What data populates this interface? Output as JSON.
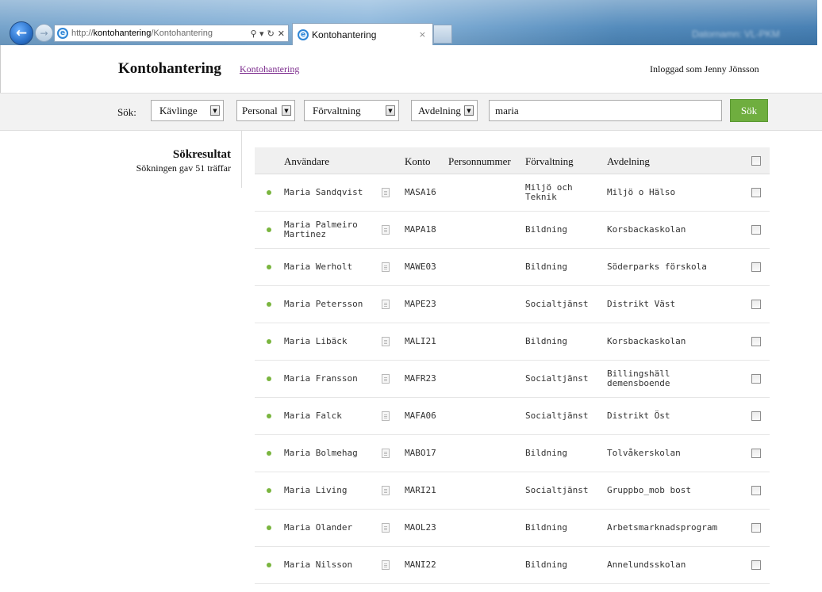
{
  "browser": {
    "address_protocol": "http://",
    "address_host": "kontohantering",
    "address_path": "/Kontohantering",
    "tab_title": "Kontohantering",
    "tab_close": "×",
    "search_glyph": "⚲ ▾",
    "refresh_glyph": "↻",
    "stop_glyph": "✕",
    "blurred_right_text": "Datornamn: VL-PKM"
  },
  "header": {
    "app_title": "Kontohantering",
    "app_link": "Kontohantering",
    "logged_in": "Inloggad som Jenny Jönsson"
  },
  "search": {
    "label": "Sök:",
    "municipality": "Kävlinge",
    "category": "Personal",
    "department_placeholder": "Förvaltning",
    "unit_placeholder": "Avdelning",
    "query": "maria",
    "button": "Sök"
  },
  "results": {
    "title": "Sökresultat",
    "summary": "Sökningen gav 51 träffar",
    "columns": [
      "Användare",
      "Konto",
      "Personnummer",
      "Förvaltning",
      "Avdelning"
    ],
    "rows": [
      {
        "user": [
          "Maria Sandqvist"
        ],
        "account": "MASA16",
        "pnr": "",
        "dept": [
          "Miljö och",
          "Teknik"
        ],
        "unit": [
          "Miljö o Hälso"
        ]
      },
      {
        "user": [
          "Maria Palmeiro",
          "Martinez"
        ],
        "account": "MAPA18",
        "pnr": "",
        "dept": [
          "Bildning"
        ],
        "unit": [
          "Korsbackaskolan"
        ]
      },
      {
        "user": [
          "Maria Werholt"
        ],
        "account": "MAWE03",
        "pnr": "",
        "dept": [
          "Bildning"
        ],
        "unit": [
          "Söderparks förskola"
        ]
      },
      {
        "user": [
          "Maria Petersson"
        ],
        "account": "MAPE23",
        "pnr": "",
        "dept": [
          "Socialtjänst"
        ],
        "unit": [
          "Distrikt Väst"
        ]
      },
      {
        "user": [
          "Maria Libäck"
        ],
        "account": "MALI21",
        "pnr": "",
        "dept": [
          "Bildning"
        ],
        "unit": [
          "Korsbackaskolan"
        ]
      },
      {
        "user": [
          "Maria Fransson"
        ],
        "account": "MAFR23",
        "pnr": "",
        "dept": [
          "Socialtjänst"
        ],
        "unit": [
          "Billingshäll",
          "demensboende"
        ]
      },
      {
        "user": [
          "Maria Falck"
        ],
        "account": "MAFA06",
        "pnr": "",
        "dept": [
          "Socialtjänst"
        ],
        "unit": [
          "Distrikt Öst"
        ]
      },
      {
        "user": [
          "Maria Bolmehag"
        ],
        "account": "MABO17",
        "pnr": "",
        "dept": [
          "Bildning"
        ],
        "unit": [
          "Tolvåkerskolan"
        ]
      },
      {
        "user": [
          "Maria Living"
        ],
        "account": "MARI21",
        "pnr": "",
        "dept": [
          "Socialtjänst"
        ],
        "unit": [
          "Gruppbo_mob bost"
        ]
      },
      {
        "user": [
          "Maria Olander"
        ],
        "account": "MAOL23",
        "pnr": "",
        "dept": [
          "Bildning"
        ],
        "unit": [
          "Arbetsmarknadsprogram"
        ]
      },
      {
        "user": [
          "Maria Nilsson"
        ],
        "account": "MANI22",
        "pnr": "",
        "dept": [
          "Bildning"
        ],
        "unit": [
          "Annelundsskolan"
        ]
      }
    ]
  },
  "colors": {
    "status_active": "#7ab53f",
    "search_button": "#6fae3f",
    "link": "#7b2a8c"
  },
  "icons": {
    "status": "status-dot-icon",
    "details": "document-icon",
    "back": "back-arrow-icon",
    "forward": "forward-arrow-icon",
    "browser": "ie-logo-icon"
  }
}
